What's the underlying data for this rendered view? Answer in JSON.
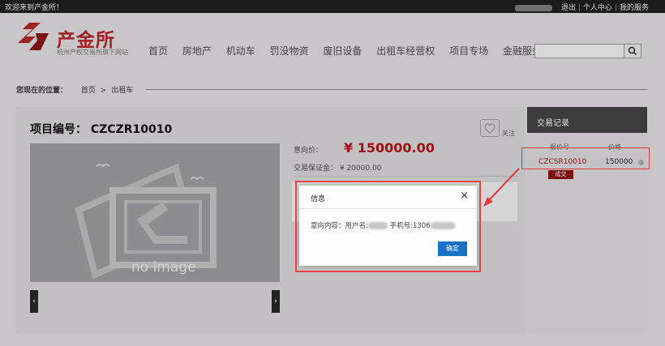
{
  "topbar": {
    "welcome": "欢迎来到产金所！",
    "logout": "退出",
    "personal_center": "个人中心",
    "my_services": "我的服务"
  },
  "header": {
    "logo_name": "产金所",
    "logo_subtitle": "杭州产权交易所旗下网站",
    "nav": [
      "首页",
      "房地产",
      "机动车",
      "罚没物资",
      "废旧设备",
      "出租车经营权",
      "项目专场",
      "金融服务"
    ],
    "search_placeholder": "",
    "brand_color": "#a02222"
  },
  "breadcrumb": {
    "label": "您现在的位置：",
    "home": "首页",
    "separator": ">",
    "current": "出租车"
  },
  "project": {
    "title": "项目编号： CZCZR10010",
    "follow_label": "关注",
    "no_image": "no image",
    "price_label": "意向价：",
    "price_value": "¥ 150000.00",
    "deposit_text": "交易保证金：  ¥ 20000.00"
  },
  "records": {
    "title": "交易记录",
    "col_code": "报价号",
    "col_price": "价格",
    "rows": [
      {
        "code": "CZCSR10010",
        "price": "150000",
        "status": "成交"
      }
    ]
  },
  "modal": {
    "title": "信息",
    "close": "×",
    "content_prefix": "意向内容：用户名:",
    "phone_prefix": " 手机号:1306",
    "ok": "确定"
  }
}
